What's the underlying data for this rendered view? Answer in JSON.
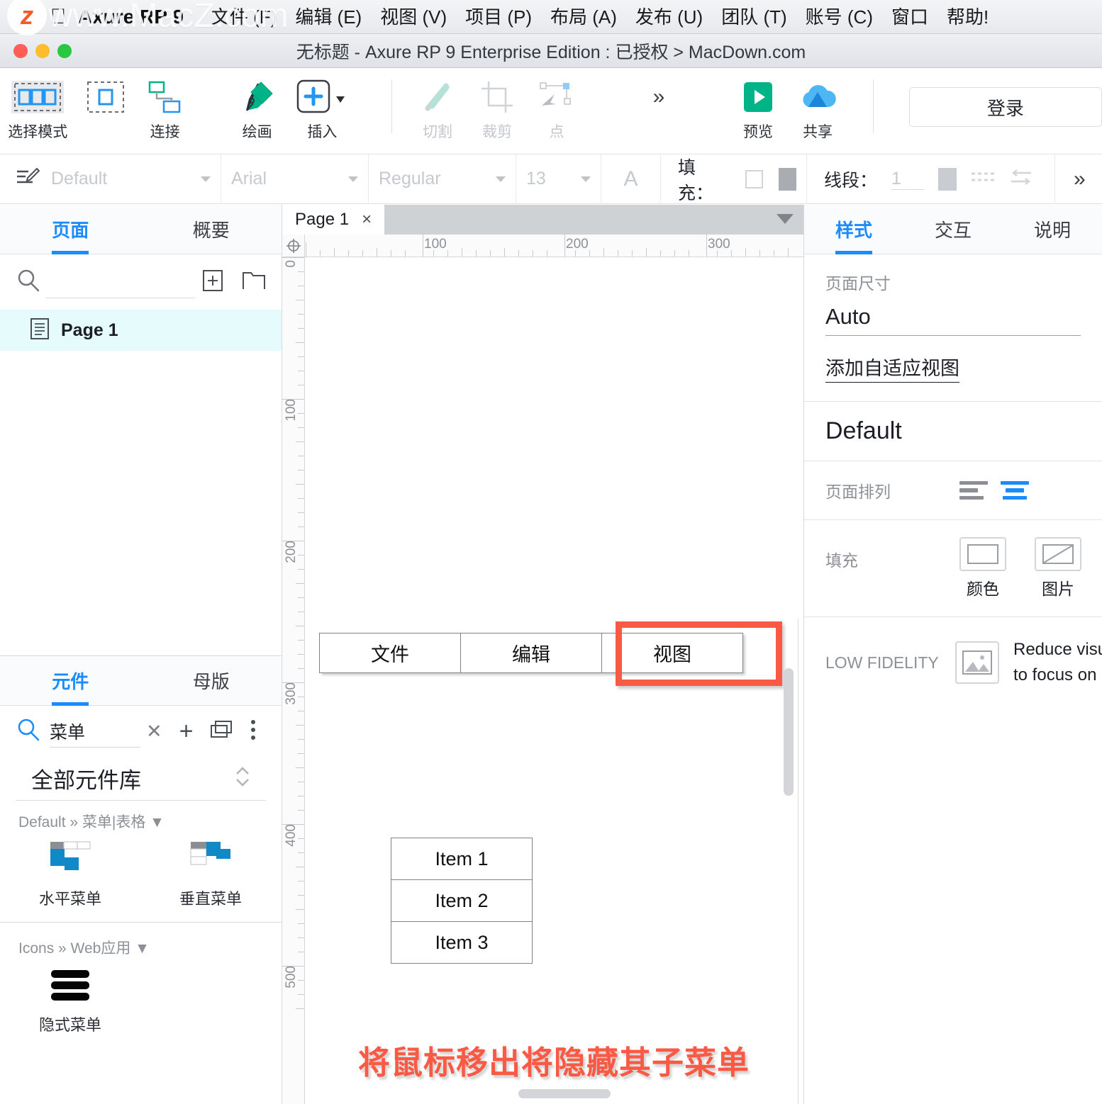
{
  "menubar": {
    "apple_icon": "apple-logo",
    "app_name": "Axure RP 9",
    "items": [
      {
        "label": "文件 (F)"
      },
      {
        "label": "编辑 (E)"
      },
      {
        "label": "视图 (V)"
      },
      {
        "label": "项目 (P)"
      },
      {
        "label": "布局 (A)"
      },
      {
        "label": "发布 (U)"
      },
      {
        "label": "团队 (T)"
      },
      {
        "label": "账号 (C)"
      },
      {
        "label": "窗口"
      },
      {
        "label": "帮助!"
      }
    ]
  },
  "watermark": {
    "badge": "z",
    "text": "www.MacZ.com"
  },
  "titlebar": {
    "title": "无标题 - Axure RP 9 Enterprise Edition : 已授权 > MacDown.com"
  },
  "toolbar": {
    "tools": [
      {
        "name": "select-mode",
        "label": "选择模式",
        "icon": "multi-select-icon",
        "disabled": false,
        "active": true
      },
      {
        "name": "single-select",
        "label": "",
        "icon": "single-select-icon",
        "disabled": false,
        "active": false
      },
      {
        "name": "connect",
        "label": "连接",
        "icon": "connector-icon",
        "disabled": false,
        "active": false
      },
      {
        "name": "draw",
        "label": "绘画",
        "icon": "pen-icon",
        "disabled": false,
        "active": false
      },
      {
        "name": "insert",
        "label": "插入",
        "icon": "plus-box-icon",
        "disabled": false,
        "active": false
      },
      {
        "name": "cut",
        "label": "切割",
        "icon": "slice-icon",
        "disabled": true,
        "active": false
      },
      {
        "name": "crop",
        "label": "裁剪",
        "icon": "crop-icon",
        "disabled": true,
        "active": false
      },
      {
        "name": "point",
        "label": "点",
        "icon": "point-icon",
        "disabled": true,
        "active": false
      }
    ],
    "overflow": "»",
    "preview": {
      "label": "预览",
      "icon": "play-icon",
      "color": "#00b487"
    },
    "share": {
      "label": "共享",
      "icon": "cloud-icon",
      "color": "#2196f3"
    },
    "login_label": "登录"
  },
  "formatbar": {
    "style_name": "Default",
    "font_family": "Arial",
    "font_weight": "Regular",
    "font_size": "13",
    "text_color_icon": "A",
    "fill_label": "填充：",
    "line_label": "线段：",
    "line_width": "1",
    "overflow": "»"
  },
  "left_panel": {
    "tabs": [
      {
        "label": "页面",
        "active": true
      },
      {
        "label": "概要",
        "active": false
      }
    ],
    "search_placeholder": "",
    "actions": [
      "add-page-icon",
      "add-folder-icon"
    ],
    "pages": [
      {
        "label": "Page 1",
        "icon": "page-icon",
        "selected": true
      }
    ],
    "widgets": {
      "tabs": [
        {
          "label": "元件",
          "active": true
        },
        {
          "label": "母版",
          "active": false
        }
      ],
      "search_value": "菜单",
      "clear_icon": "clear-icon",
      "add_icon": "plus-icon",
      "copy_icon": "duplicate-icon",
      "more_icon": "more-vertical-icon",
      "library_name": "全部元件库",
      "library_caret": "updown-icon",
      "groups": [
        {
          "title": "Default » 菜单|表格 ▼",
          "items": [
            {
              "label": "水平菜单",
              "icon": "horizontal-menu-icon"
            },
            {
              "label": "垂直菜单",
              "icon": "vertical-menu-icon"
            }
          ]
        },
        {
          "title": "Icons » Web应用 ▼",
          "items": [
            {
              "label": "隐式菜单",
              "icon": "hamburger-icon"
            }
          ]
        }
      ]
    }
  },
  "canvas": {
    "tab": {
      "label": "Page 1",
      "close": "×"
    },
    "ruler_h_labels": [
      "100",
      "200",
      "300"
    ],
    "ruler_v_labels": [
      "0",
      "100",
      "200",
      "300",
      "400",
      "500"
    ],
    "horizontal_menu": [
      "文件",
      "编辑",
      "视图"
    ],
    "highlight_color": "#fa5a44",
    "vertical_menu": [
      "Item 1",
      "Item 2",
      "Item 3"
    ],
    "annotation": "将鼠标移出将隐藏其子菜单"
  },
  "right_panel": {
    "tabs": [
      {
        "label": "样式",
        "active": true
      },
      {
        "label": "交互",
        "active": false
      },
      {
        "label": "说明",
        "active": false
      }
    ],
    "page_size_label": "页面尺寸",
    "page_size_value": "Auto",
    "adaptive_link": "添加自适应视图",
    "style_name": "Default",
    "page_align_label": "页面排列",
    "fill_label": "填充",
    "fill_color_label": "颜色",
    "fill_image_label": "图片",
    "low_fidelity_label": "LOW FIDELITY",
    "low_fidelity_desc_line1": "Reduce visu",
    "low_fidelity_desc_line2": "to focus on",
    "accent_color": "#1a8cff"
  }
}
